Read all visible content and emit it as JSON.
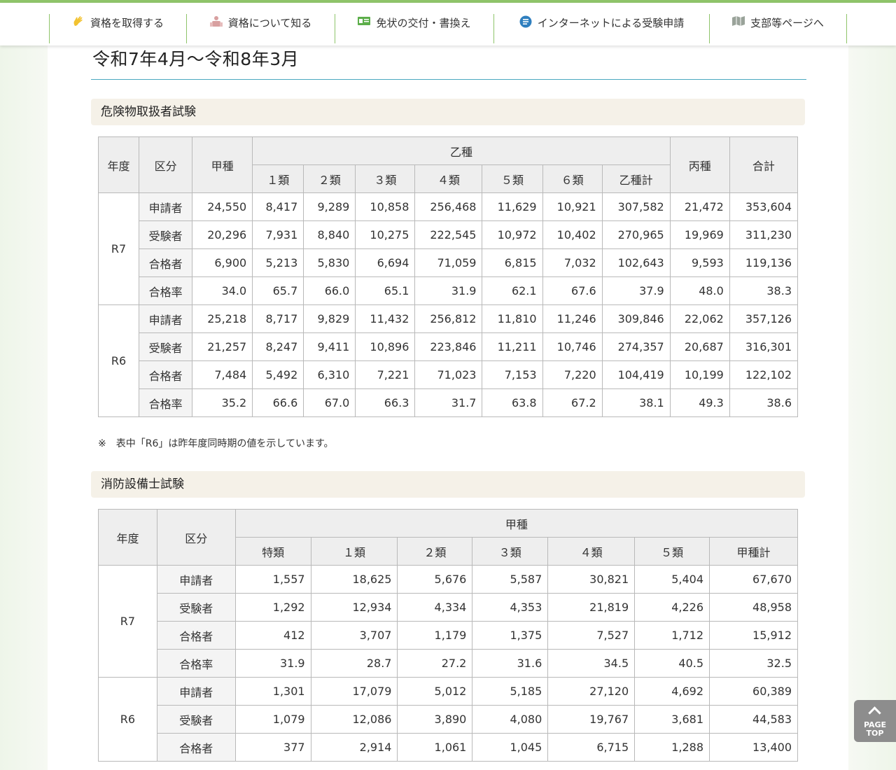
{
  "nav": {
    "items": [
      {
        "label": "資格を取得する",
        "icon": "hand-icon"
      },
      {
        "label": "資格について知る",
        "icon": "person-group-icon"
      },
      {
        "label": "免状の交付・書換え",
        "icon": "license-card-icon"
      },
      {
        "label": "インターネットによる受験申請",
        "icon": "internet-application-icon"
      },
      {
        "label": "支部等ページへ",
        "icon": "map-icon"
      }
    ]
  },
  "page": {
    "title": "令和7年4月～令和8年3月"
  },
  "section1": {
    "title": "危険物取扱者試験",
    "headers": {
      "year": "年度",
      "kubun": "区分",
      "koushu": "甲種",
      "otsushu": "乙種",
      "otsu_sub": [
        "１類",
        "２類",
        "３類",
        "４類",
        "５類",
        "６類",
        "乙種計"
      ],
      "heishu": "丙種",
      "total": "合計"
    },
    "groups": [
      {
        "year": "R7",
        "rows": [
          {
            "label": "申請者",
            "values": [
              "24,550",
              "8,417",
              "9,289",
              "10,858",
              "256,468",
              "11,629",
              "10,921",
              "307,582",
              "21,472",
              "353,604"
            ]
          },
          {
            "label": "受験者",
            "values": [
              "20,296",
              "7,931",
              "8,840",
              "10,275",
              "222,545",
              "10,972",
              "10,402",
              "270,965",
              "19,969",
              "311,230"
            ]
          },
          {
            "label": "合格者",
            "values": [
              "6,900",
              "5,213",
              "5,830",
              "6,694",
              "71,059",
              "6,815",
              "7,032",
              "102,643",
              "9,593",
              "119,136"
            ]
          },
          {
            "label": "合格率",
            "values": [
              "34.0",
              "65.7",
              "66.0",
              "65.1",
              "31.9",
              "62.1",
              "67.6",
              "37.9",
              "48.0",
              "38.3"
            ]
          }
        ]
      },
      {
        "year": "R6",
        "rows": [
          {
            "label": "申請者",
            "values": [
              "25,218",
              "8,717",
              "9,829",
              "11,432",
              "256,812",
              "11,810",
              "11,246",
              "309,846",
              "22,062",
              "357,126"
            ]
          },
          {
            "label": "受験者",
            "values": [
              "21,257",
              "8,247",
              "9,411",
              "10,896",
              "223,846",
              "11,211",
              "10,746",
              "274,357",
              "20,687",
              "316,301"
            ]
          },
          {
            "label": "合格者",
            "values": [
              "7,484",
              "5,492",
              "6,310",
              "7,221",
              "71,023",
              "7,153",
              "7,220",
              "104,419",
              "10,199",
              "122,102"
            ]
          },
          {
            "label": "合格率",
            "values": [
              "35.2",
              "66.6",
              "67.0",
              "66.3",
              "31.7",
              "63.8",
              "67.2",
              "38.1",
              "49.3",
              "38.6"
            ]
          }
        ]
      }
    ],
    "note": "※　表中「R6」は昨年度同時期の値を示しています。"
  },
  "section2": {
    "title": "消防設備士試験",
    "headers": {
      "year": "年度",
      "kubun": "区分",
      "koushu": "甲種",
      "sub": [
        "特類",
        "１類",
        "２類",
        "３類",
        "４類",
        "５類",
        "甲種計"
      ]
    },
    "groups": [
      {
        "year": "R7",
        "rows": [
          {
            "label": "申請者",
            "values": [
              "1,557",
              "18,625",
              "5,676",
              "5,587",
              "30,821",
              "5,404",
              "67,670"
            ]
          },
          {
            "label": "受験者",
            "values": [
              "1,292",
              "12,934",
              "4,334",
              "4,353",
              "21,819",
              "4,226",
              "48,958"
            ]
          },
          {
            "label": "合格者",
            "values": [
              "412",
              "3,707",
              "1,179",
              "1,375",
              "7,527",
              "1,712",
              "15,912"
            ]
          },
          {
            "label": "合格率",
            "values": [
              "31.9",
              "28.7",
              "27.2",
              "31.6",
              "34.5",
              "40.5",
              "32.5"
            ]
          }
        ]
      },
      {
        "year": "R6",
        "rows": [
          {
            "label": "申請者",
            "values": [
              "1,301",
              "17,079",
              "5,012",
              "5,185",
              "27,120",
              "4,692",
              "60,389"
            ]
          },
          {
            "label": "受験者",
            "values": [
              "1,079",
              "12,086",
              "3,890",
              "4,080",
              "19,767",
              "3,681",
              "44,583"
            ]
          },
          {
            "label": "合格者",
            "values": [
              "377",
              "2,914",
              "1,061",
              "1,045",
              "6,715",
              "1,288",
              "13,400"
            ]
          }
        ]
      }
    ]
  },
  "pagetop": {
    "line1": "PAGE",
    "line2": "TOP"
  }
}
